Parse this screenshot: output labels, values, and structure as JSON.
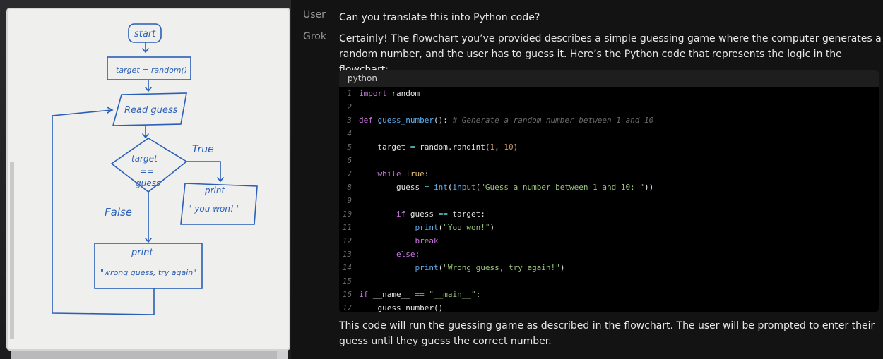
{
  "chat": {
    "user_role": "User",
    "user_message": "Can you translate this into Python code?",
    "assistant_role": "Grok",
    "assistant_intro": "Certainly! The flowchart you’ve provided describes a simple guessing game where the computer generates a random number, and the user has to guess it. Here’s the Python code that represents the logic in the flowchart:",
    "assistant_outro": "This code will run the guessing game as described in the flowchart. The user will be prompted to enter their guess until they guess the correct number."
  },
  "code": {
    "language": "python",
    "lines": [
      {
        "n": "1",
        "tokens": [
          [
            "kw",
            "import"
          ],
          [
            "tx",
            " random"
          ]
        ]
      },
      {
        "n": "2",
        "tokens": []
      },
      {
        "n": "3",
        "tokens": [
          [
            "kw",
            "def"
          ],
          [
            "tx",
            " "
          ],
          [
            "fn",
            "guess_number"
          ],
          [
            "tx",
            "(): "
          ],
          [
            "cm",
            "# Generate a random number between 1 and 10"
          ]
        ]
      },
      {
        "n": "4",
        "tokens": []
      },
      {
        "n": "5",
        "tokens": [
          [
            "tx",
            "    target "
          ],
          [
            "op",
            "="
          ],
          [
            "tx",
            " random.randint("
          ],
          [
            "num",
            "1"
          ],
          [
            "tx",
            ", "
          ],
          [
            "num",
            "10"
          ],
          [
            "tx",
            ")"
          ]
        ]
      },
      {
        "n": "6",
        "tokens": []
      },
      {
        "n": "7",
        "tokens": [
          [
            "tx",
            "    "
          ],
          [
            "kw",
            "while"
          ],
          [
            "tx",
            " "
          ],
          [
            "bi",
            "True"
          ],
          [
            "tx",
            ":"
          ]
        ]
      },
      {
        "n": "8",
        "tokens": [
          [
            "tx",
            "        guess "
          ],
          [
            "op",
            "="
          ],
          [
            "tx",
            " "
          ],
          [
            "fn",
            "int"
          ],
          [
            "tx",
            "("
          ],
          [
            "fn",
            "input"
          ],
          [
            "tx",
            "("
          ],
          [
            "str",
            "\"Guess a number between 1 and 10: \""
          ],
          [
            "tx",
            "))"
          ]
        ]
      },
      {
        "n": "9",
        "tokens": []
      },
      {
        "n": "10",
        "tokens": [
          [
            "tx",
            "        "
          ],
          [
            "kw",
            "if"
          ],
          [
            "tx",
            " guess "
          ],
          [
            "op",
            "=="
          ],
          [
            "tx",
            " target:"
          ]
        ]
      },
      {
        "n": "11",
        "tokens": [
          [
            "tx",
            "            "
          ],
          [
            "fn",
            "print"
          ],
          [
            "tx",
            "("
          ],
          [
            "str",
            "\"You won!\""
          ],
          [
            "tx",
            ")"
          ]
        ]
      },
      {
        "n": "12",
        "tokens": [
          [
            "tx",
            "            "
          ],
          [
            "kw",
            "break"
          ]
        ]
      },
      {
        "n": "13",
        "tokens": [
          [
            "tx",
            "        "
          ],
          [
            "kw",
            "else"
          ],
          [
            "tx",
            ":"
          ]
        ]
      },
      {
        "n": "14",
        "tokens": [
          [
            "tx",
            "            "
          ],
          [
            "fn",
            "print"
          ],
          [
            "tx",
            "("
          ],
          [
            "str",
            "\"Wrong guess, try again!\""
          ],
          [
            "tx",
            ")"
          ]
        ]
      },
      {
        "n": "15",
        "tokens": []
      },
      {
        "n": "16",
        "tokens": [
          [
            "kw",
            "if"
          ],
          [
            "tx",
            " __name__ "
          ],
          [
            "op",
            "=="
          ],
          [
            "tx",
            " "
          ],
          [
            "str",
            "\"__main__\""
          ],
          [
            "tx",
            ":"
          ]
        ]
      },
      {
        "n": "17",
        "tokens": [
          [
            "tx",
            "    guess_number()"
          ]
        ]
      }
    ]
  },
  "whiteboard": {
    "start": "start",
    "target_assign": "target = random()",
    "read_guess": "Read guess",
    "decision_1": "target",
    "decision_2": "==",
    "decision_3": "guess",
    "true_label": "True",
    "false_label": "False",
    "print_win_1": "print",
    "print_win_2": "\" you won! \"",
    "print_lose_1": "print",
    "print_lose_2": "\"wrong guess, try again\""
  },
  "colors": {
    "background": "#131313",
    "marker": "#2a5fb8",
    "code_bg": "#000000"
  }
}
